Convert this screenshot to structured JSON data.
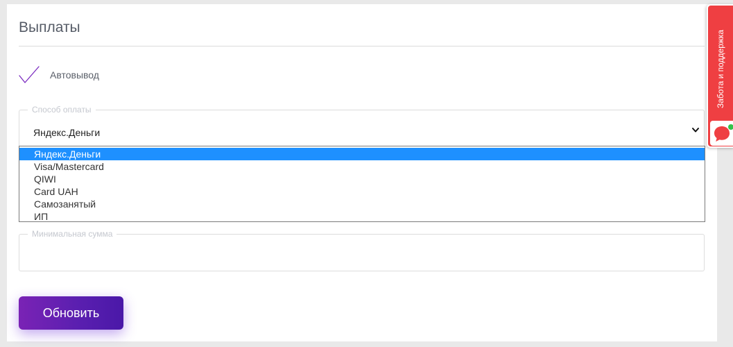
{
  "payouts": {
    "title": "Выплаты",
    "autowithdraw": {
      "label": "Автовывод",
      "checked": true,
      "check_color": "#7b2bc0"
    },
    "payment_method": {
      "legend": "Способ оплаты",
      "selected_value": "Яндекс.Деньги",
      "options": [
        "Яндекс.Деньги",
        "Visa/Mastercard",
        "QIWI",
        "Card UAH",
        "Самозанятый",
        "ИП"
      ],
      "highlighted_index": 0,
      "highlight_color": "#1e90ff"
    },
    "min_amount": {
      "legend": "Минимальная сумма",
      "value": ""
    },
    "update_button": {
      "label": "Обновить",
      "gradient": [
        "#7a23b5",
        "#4a18a8"
      ]
    }
  },
  "support_widget": {
    "label": "Забота и поддержка",
    "icon": "chat-bubble-icon",
    "status": "online",
    "color": "#ef3f42",
    "status_color": "#34c24a"
  }
}
